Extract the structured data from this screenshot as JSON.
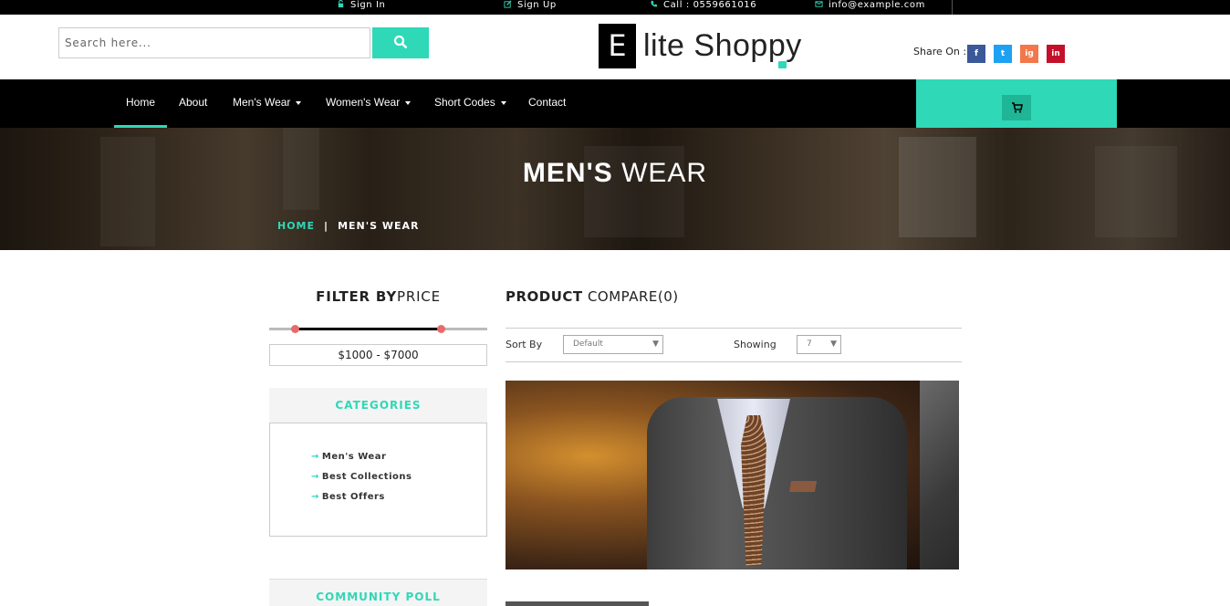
{
  "topbar": {
    "signin": "Sign In",
    "signup": "Sign Up",
    "call": "Call : 0559661016",
    "email": "info@example.com"
  },
  "header": {
    "search_placeholder": "Search here...",
    "logo_letter": "E",
    "logo_text": "lite Shoppy",
    "share_label": "Share On :",
    "social": [
      "f",
      "t",
      "ig",
      "in"
    ]
  },
  "nav": {
    "items": [
      {
        "label": "Home",
        "active": true,
        "dropdown": false
      },
      {
        "label": "About",
        "dropdown": false
      },
      {
        "label": "Men's Wear",
        "dropdown": true
      },
      {
        "label": "Women's Wear",
        "dropdown": true
      },
      {
        "label": "Short Codes",
        "dropdown": true
      },
      {
        "label": "Contact",
        "dropdown": false
      }
    ]
  },
  "banner": {
    "title_bold": "MEN'S",
    "title_rest": " WEAR",
    "crumb_home": "HOME",
    "crumb_sep": "|",
    "crumb_current": "MEN'S WEAR"
  },
  "sidebar": {
    "filter_bold": "FILTER BY",
    "filter_rest": "PRICE",
    "price_range": "$1000 - $7000",
    "price_min_frac": 0.12,
    "price_max_frac": 0.79,
    "categories_title": "CATEGORIES",
    "categories": [
      "Men's Wear",
      "Best Collections",
      "Best Offers"
    ],
    "poll_title": "COMMUNITY POLL"
  },
  "main": {
    "title_bold": "PRODUCT",
    "title_rest": " COMPARE(0)",
    "sort_label": "Sort By",
    "sort_value": "Default",
    "showing_label": "Showing",
    "showing_value": "7"
  },
  "colors": {
    "accent": "#2fd8b7",
    "facebook": "#3b5998",
    "twitter": "#1da1f2",
    "instagram": "#f2784b",
    "linkedin": "#c4102a",
    "slider_handle": "#e86a6a"
  }
}
